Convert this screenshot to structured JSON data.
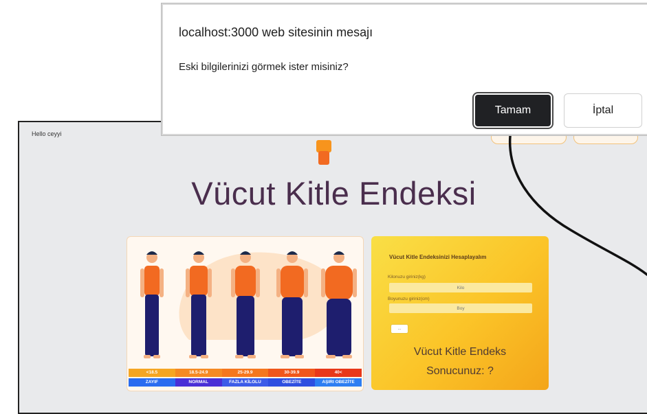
{
  "app": {
    "greeting": "Hello ceyyi",
    "title": "Vücut Kitle Endeksi"
  },
  "bmi_chart": {
    "ranges": [
      "<18.5",
      "18.5-24.9",
      "25-29.9",
      "30-39.9",
      "40<"
    ],
    "categories": [
      "ZAYIF",
      "NORMAL",
      "FAZLA KİLOLU",
      "OBEZİTE",
      "AŞIRI OBEZİTE"
    ],
    "range_colors": [
      "#f5a623",
      "#f58a23",
      "#f5771f",
      "#f0561b",
      "#e8381a"
    ],
    "category_colors": [
      "#2a6cf0",
      "#4a2fd6",
      "#3d5ce8",
      "#2f4fe0",
      "#2d7ef2"
    ]
  },
  "calculator": {
    "title": "Vücut Kitle Endeksinizi Hesaplayalım",
    "weight_label": "Kilonuzu giriniz(kg)",
    "weight_placeholder": "Kilo",
    "height_label": "Boyunuzu giriniz(cm)",
    "height_placeholder": "Boy",
    "submit_label": "...",
    "result_line1": "Vücut Kitle Endeks",
    "result_line2": "Sonucunuz: ?"
  },
  "dialog": {
    "origin": "localhost:3000 web sitesinin mesajı",
    "message": "Eski bilgilerinizi görmek ister misiniz?",
    "ok_label": "Tamam",
    "cancel_label": "İptal"
  },
  "colors": {
    "title_color": "#4a2e4d",
    "ok_button_bg": "#202124",
    "shirt": "#f26a21",
    "pants": "#1e1e6e",
    "hair": "#1c2a4a",
    "skin": "#f4b183"
  }
}
